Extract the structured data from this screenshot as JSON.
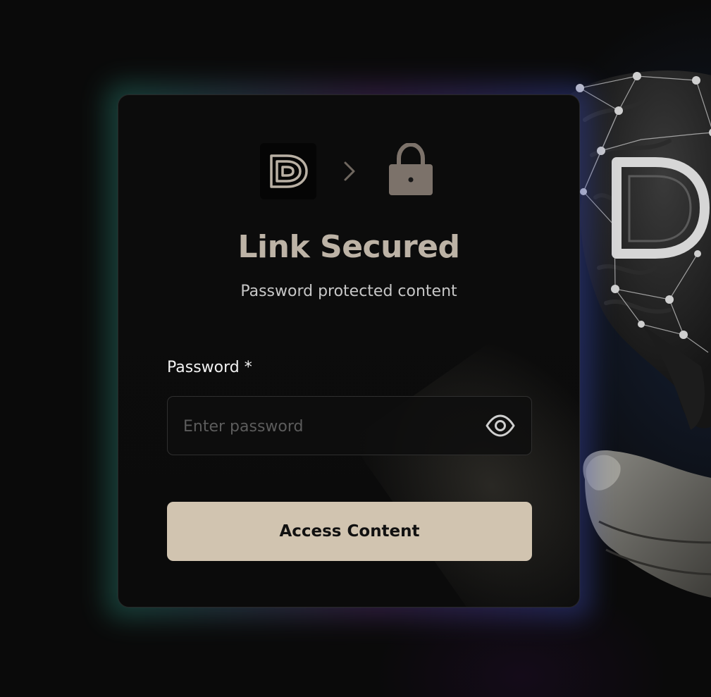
{
  "brand": {
    "logo_icon": "d-logo-icon",
    "chevron_icon": "chevron-right-icon",
    "lock_icon": "lock-icon"
  },
  "card": {
    "title": "Link Secured",
    "subtitle": "Password protected content"
  },
  "form": {
    "password_label": "Password *",
    "password_placeholder": "Enter password",
    "password_value": "",
    "toggle_icon": "eye-icon",
    "submit_label": "Access Content"
  },
  "colors": {
    "accent_button": "#d1c4b0",
    "title_color": "#bdb3a6",
    "lock_color": "#7c726a",
    "background": "#0a0a0a"
  }
}
